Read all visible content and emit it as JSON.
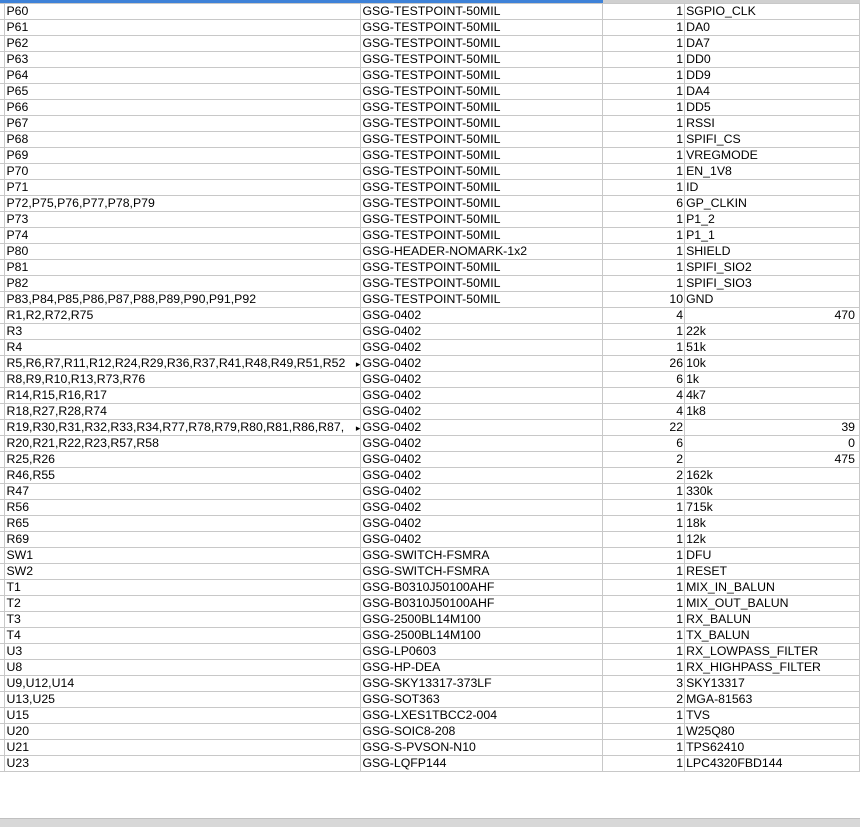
{
  "rows": [
    {
      "ref": "P60",
      "pkg": "GSG-TESTPOINT-50MIL",
      "qty": "1",
      "value": "SGPIO_CLK"
    },
    {
      "ref": "P61",
      "pkg": "GSG-TESTPOINT-50MIL",
      "qty": "1",
      "value": "DA0"
    },
    {
      "ref": "P62",
      "pkg": "GSG-TESTPOINT-50MIL",
      "qty": "1",
      "value": "DA7"
    },
    {
      "ref": "P63",
      "pkg": "GSG-TESTPOINT-50MIL",
      "qty": "1",
      "value": "DD0"
    },
    {
      "ref": "P64",
      "pkg": "GSG-TESTPOINT-50MIL",
      "qty": "1",
      "value": "DD9"
    },
    {
      "ref": "P65",
      "pkg": "GSG-TESTPOINT-50MIL",
      "qty": "1",
      "value": "DA4"
    },
    {
      "ref": "P66",
      "pkg": "GSG-TESTPOINT-50MIL",
      "qty": "1",
      "value": "DD5"
    },
    {
      "ref": "P67",
      "pkg": "GSG-TESTPOINT-50MIL",
      "qty": "1",
      "value": "RSSI"
    },
    {
      "ref": "P68",
      "pkg": "GSG-TESTPOINT-50MIL",
      "qty": "1",
      "value": "SPIFI_CS"
    },
    {
      "ref": "P69",
      "pkg": "GSG-TESTPOINT-50MIL",
      "qty": "1",
      "value": "VREGMODE"
    },
    {
      "ref": "P70",
      "pkg": "GSG-TESTPOINT-50MIL",
      "qty": "1",
      "value": "EN_1V8"
    },
    {
      "ref": "P71",
      "pkg": "GSG-TESTPOINT-50MIL",
      "qty": "1",
      "value": "ID"
    },
    {
      "ref": "P72,P75,P76,P77,P78,P79",
      "pkg": "GSG-TESTPOINT-50MIL",
      "qty": "6",
      "value": "GP_CLKIN"
    },
    {
      "ref": "P73",
      "pkg": "GSG-TESTPOINT-50MIL",
      "qty": "1",
      "value": "P1_2"
    },
    {
      "ref": "P74",
      "pkg": "GSG-TESTPOINT-50MIL",
      "qty": "1",
      "value": "P1_1"
    },
    {
      "ref": "P80",
      "pkg": "GSG-HEADER-NOMARK-1x2",
      "qty": "1",
      "value": "SHIELD"
    },
    {
      "ref": "P81",
      "pkg": "GSG-TESTPOINT-50MIL",
      "qty": "1",
      "value": "SPIFI_SIO2"
    },
    {
      "ref": "P82",
      "pkg": "GSG-TESTPOINT-50MIL",
      "qty": "1",
      "value": "SPIFI_SIO3"
    },
    {
      "ref": "P83,P84,P85,P86,P87,P88,P89,P90,P91,P92",
      "pkg": "GSG-TESTPOINT-50MIL",
      "qty": "10",
      "value": "GND"
    },
    {
      "ref": "R1,R2,R72,R75",
      "pkg": "GSG-0402",
      "qty": "4",
      "value": "470",
      "numeric": true
    },
    {
      "ref": "R3",
      "pkg": "GSG-0402",
      "qty": "1",
      "value": "22k"
    },
    {
      "ref": "R4",
      "pkg": "GSG-0402",
      "qty": "1",
      "value": "51k"
    },
    {
      "ref": "R5,R6,R7,R11,R12,R24,R29,R36,R37,R41,R48,R49,R51,R52",
      "pkg": "GSG-0402",
      "qty": "26",
      "value": "10k",
      "overflow": true
    },
    {
      "ref": "R8,R9,R10,R13,R73,R76",
      "pkg": "GSG-0402",
      "qty": "6",
      "value": "1k"
    },
    {
      "ref": "R14,R15,R16,R17",
      "pkg": "GSG-0402",
      "qty": "4",
      "value": "4k7"
    },
    {
      "ref": "R18,R27,R28,R74",
      "pkg": "GSG-0402",
      "qty": "4",
      "value": "1k8"
    },
    {
      "ref": "R19,R30,R31,R32,R33,R34,R77,R78,R79,R80,R81,R86,R87,",
      "pkg": "GSG-0402",
      "qty": "22",
      "value": "39",
      "numeric": true,
      "overflow": true
    },
    {
      "ref": "R20,R21,R22,R23,R57,R58",
      "pkg": "GSG-0402",
      "qty": "6",
      "value": "0",
      "numeric": true
    },
    {
      "ref": "R25,R26",
      "pkg": "GSG-0402",
      "qty": "2",
      "value": "475",
      "numeric": true
    },
    {
      "ref": "R46,R55",
      "pkg": "GSG-0402",
      "qty": "2",
      "value": "162k"
    },
    {
      "ref": "R47",
      "pkg": "GSG-0402",
      "qty": "1",
      "value": "330k"
    },
    {
      "ref": "R56",
      "pkg": "GSG-0402",
      "qty": "1",
      "value": "715k"
    },
    {
      "ref": "R65",
      "pkg": "GSG-0402",
      "qty": "1",
      "value": "18k"
    },
    {
      "ref": "R69",
      "pkg": "GSG-0402",
      "qty": "1",
      "value": "12k"
    },
    {
      "ref": "SW1",
      "pkg": "GSG-SWITCH-FSMRA",
      "qty": "1",
      "value": "DFU"
    },
    {
      "ref": "SW2",
      "pkg": "GSG-SWITCH-FSMRA",
      "qty": "1",
      "value": "RESET"
    },
    {
      "ref": "T1",
      "pkg": "GSG-B0310J50100AHF",
      "qty": "1",
      "value": "MIX_IN_BALUN"
    },
    {
      "ref": "T2",
      "pkg": "GSG-B0310J50100AHF",
      "qty": "1",
      "value": "MIX_OUT_BALUN"
    },
    {
      "ref": "T3",
      "pkg": "GSG-2500BL14M100",
      "qty": "1",
      "value": "RX_BALUN"
    },
    {
      "ref": "T4",
      "pkg": "GSG-2500BL14M100",
      "qty": "1",
      "value": "TX_BALUN"
    },
    {
      "ref": "U3",
      "pkg": "GSG-LP0603",
      "qty": "1",
      "value": "RX_LOWPASS_FILTER"
    },
    {
      "ref": "U8",
      "pkg": "GSG-HP-DEA",
      "qty": "1",
      "value": "RX_HIGHPASS_FILTER"
    },
    {
      "ref": "U9,U12,U14",
      "pkg": "GSG-SKY13317-373LF",
      "qty": "3",
      "value": "SKY13317"
    },
    {
      "ref": "U13,U25",
      "pkg": "GSG-SOT363",
      "qty": "2",
      "value": "MGA-81563"
    },
    {
      "ref": "U15",
      "pkg": "GSG-LXES1TBCC2-004",
      "qty": "1",
      "value": "TVS"
    },
    {
      "ref": "U20",
      "pkg": "GSG-SOIC8-208",
      "qty": "1",
      "value": "W25Q80"
    },
    {
      "ref": "U21",
      "pkg": "GSG-S-PVSON-N10",
      "qty": "1",
      "value": "TPS62410"
    },
    {
      "ref": "U23",
      "pkg": "GSG-LQFP144",
      "qty": "1",
      "value": "LPC4320FBD144"
    }
  ]
}
